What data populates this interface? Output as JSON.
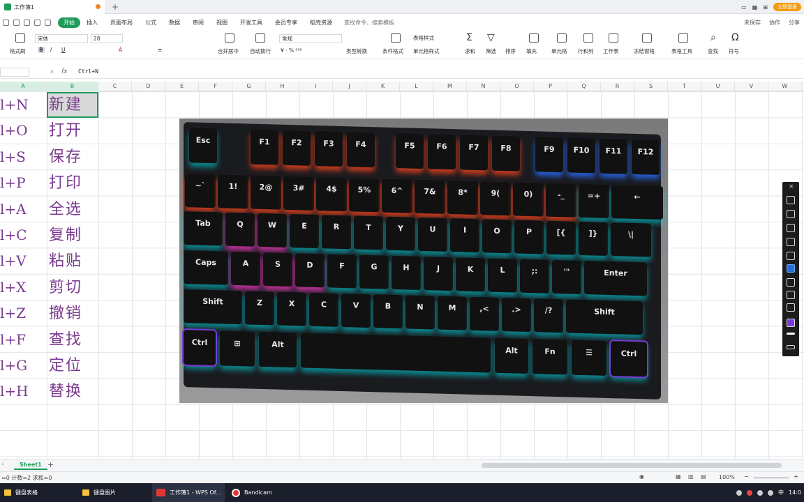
{
  "window": {
    "doc_title": "工作簿1",
    "login": "立即登录"
  },
  "menu": {
    "items": [
      "开始",
      "插入",
      "页面布局",
      "公式",
      "数据",
      "审阅",
      "视图",
      "开发工具",
      "会员专享",
      "稻壳资源"
    ],
    "search": "查找命令、搜索模板",
    "unsaved": "未保存",
    "collab": "协作",
    "share": "分享"
  },
  "ribbon": {
    "format_painter": "格式刷",
    "font": "宋体",
    "size": "28",
    "number_format": "常规",
    "merge": "合并居中",
    "wrap": "自动换行",
    "type_convert": "类型转换",
    "cond_format": "条件格式",
    "table_style": "表格样式",
    "cell_style": "单元格样式",
    "sum": "求和",
    "filter": "筛选",
    "sort": "排序",
    "fill": "填充",
    "cell": "单元格",
    "rowcol": "行和列",
    "sheet": "工作表",
    "freeze": "冻结窗格",
    "table_tools": "表格工具",
    "find": "查找",
    "symbol": "符号"
  },
  "formula": {
    "fx": "fx",
    "content": "Ctrl+N"
  },
  "columns": [
    "A",
    "B",
    "C",
    "D",
    "E",
    "F",
    "G",
    "H",
    "I",
    "J",
    "K",
    "L",
    "M",
    "N",
    "O",
    "P",
    "Q",
    "R",
    "S",
    "T",
    "U",
    "V",
    "W"
  ],
  "rows": [
    {
      "a": "l+N",
      "b": "新建"
    },
    {
      "a": "l+O",
      "b": "打开"
    },
    {
      "a": "l+S",
      "b": "保存"
    },
    {
      "a": "l+P",
      "b": "打印"
    },
    {
      "a": "l+A",
      "b": "全选"
    },
    {
      "a": "l+C",
      "b": "复制"
    },
    {
      "a": "l+V",
      "b": "粘贴"
    },
    {
      "a": "l+X",
      "b": "剪切"
    },
    {
      "a": "l+Z",
      "b": "撤销"
    },
    {
      "a": "l+F",
      "b": "查找"
    },
    {
      "a": "l+G",
      "b": "定位"
    },
    {
      "a": "l+H",
      "b": "替换"
    }
  ],
  "keyboard": {
    "row0": [
      "Esc",
      "F1",
      "F2",
      "F3",
      "F4",
      "F5",
      "F6",
      "F7",
      "F8",
      "F9",
      "F10",
      "F11",
      "F12"
    ],
    "row1": [
      "~`",
      "1!",
      "2@",
      "3#",
      "4$",
      "5%",
      "6^",
      "7&",
      "8*",
      "9(",
      "0)",
      "-_",
      "=+",
      "←"
    ],
    "row2": [
      "Tab",
      "Q",
      "W",
      "E",
      "R",
      "T",
      "Y",
      "U",
      "I",
      "O",
      "P",
      "[{",
      "]}",
      "\\|"
    ],
    "row3": [
      "Caps",
      "A",
      "S",
      "D",
      "F",
      "G",
      "H",
      "J",
      "K",
      "L",
      ";:",
      "'\"",
      "Enter"
    ],
    "row4": [
      "Shift",
      "Z",
      "X",
      "C",
      "V",
      "B",
      "N",
      "M",
      ",<",
      ".>",
      "/?",
      "Shift"
    ],
    "row5": [
      "Ctrl",
      "⊞",
      "Alt",
      "",
      "Alt",
      "Fn",
      "☰",
      "Ctrl"
    ]
  },
  "sheet": {
    "tab": "Sheet1",
    "add": "+"
  },
  "status": {
    "text": "=0  计数=2  求和=0",
    "zoom": "100%"
  },
  "taskbar": {
    "items": [
      "键盘表格",
      "键盘图片",
      "工作簿1 - WPS Of...",
      "Bandicam"
    ],
    "clock": "14:0",
    "ime": "中"
  }
}
